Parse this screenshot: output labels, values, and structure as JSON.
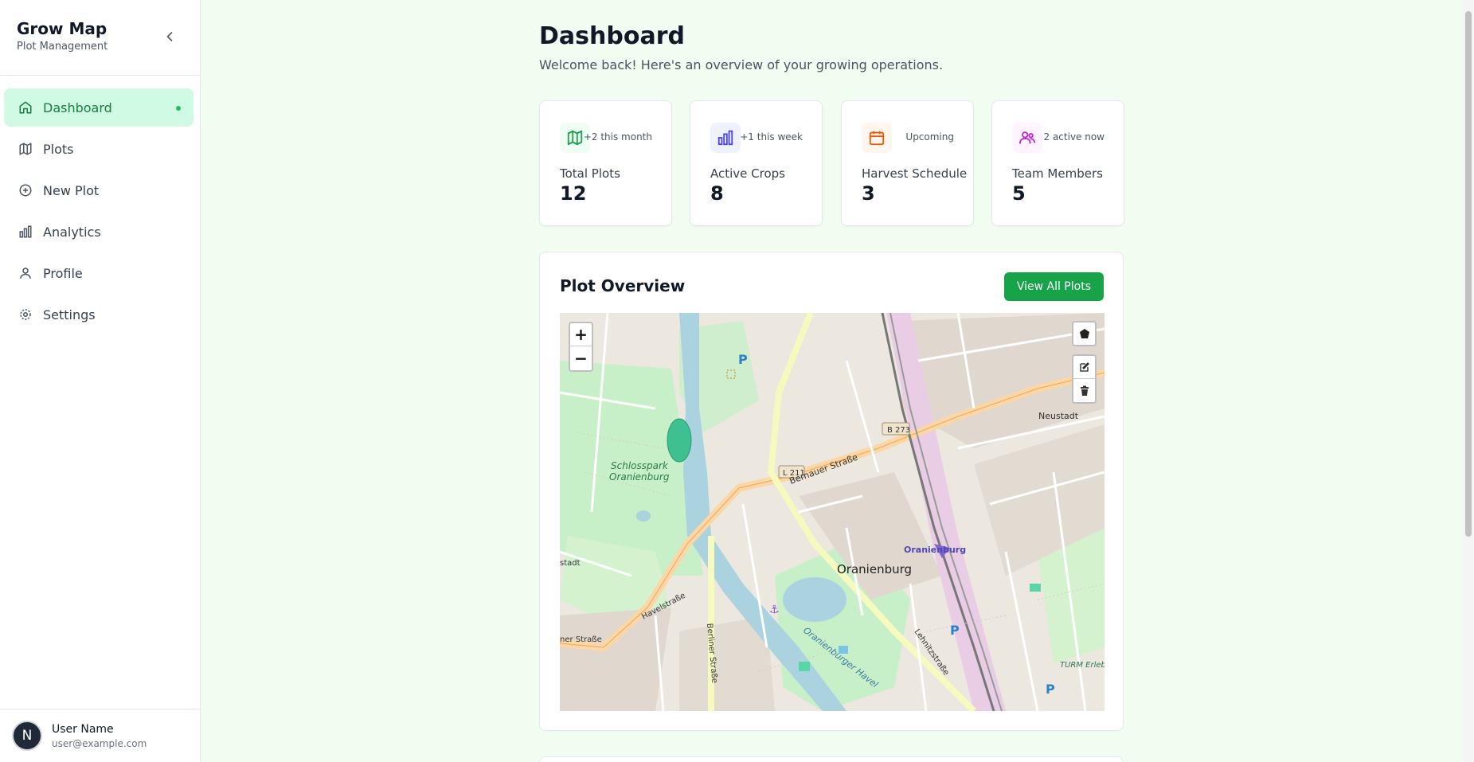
{
  "sidebar": {
    "brand_title": "Grow Map",
    "brand_subtitle": "Plot Management",
    "items": [
      {
        "label": "Dashboard",
        "icon": "home-icon",
        "active": true
      },
      {
        "label": "Plots",
        "icon": "map-icon"
      },
      {
        "label": "New Plot",
        "icon": "plus-circle-icon"
      },
      {
        "label": "Analytics",
        "icon": "bar-chart-icon"
      },
      {
        "label": "Profile",
        "icon": "user-icon"
      },
      {
        "label": "Settings",
        "icon": "gear-icon"
      }
    ],
    "user": {
      "initial": "N",
      "name": "User Name",
      "email": "user@example.com"
    }
  },
  "header": {
    "title": "Dashboard",
    "subtitle": "Welcome back! Here's an overview of your growing operations."
  },
  "stats": [
    {
      "label": "Total Plots",
      "value": "12",
      "badge": "+2 this month",
      "icon": "map-icon",
      "color": "#16a34a",
      "bg": "#f0fdf4"
    },
    {
      "label": "Active Crops",
      "value": "8",
      "badge": "+1 this week",
      "icon": "bar-chart-icon",
      "color": "#4f46e5",
      "bg": "#eef2ff"
    },
    {
      "label": "Harvest Schedule",
      "value": "3",
      "badge": "Upcoming",
      "icon": "calendar-icon",
      "color": "#ea580c",
      "bg": "#fff7ed"
    },
    {
      "label": "Team Members",
      "value": "5",
      "badge": "2 active now",
      "icon": "users-icon",
      "color": "#c026d3",
      "bg": "#fdf4ff"
    }
  ],
  "overview": {
    "title": "Plot Overview",
    "button": "View All Plots"
  },
  "map": {
    "zoom_in": "+",
    "zoom_out": "−",
    "labels": {
      "town": "Oranienburg",
      "park": "Schlosspark",
      "park2": "Oranienburg",
      "station": "Oranienburg",
      "neustadt": "Neustadt",
      "b273": "B 273",
      "l211": "L 211",
      "bernauer": "Bernauer Straße",
      "havelstr": "Havelstraße",
      "berliner": "Berliner Straße",
      "lehnitz": "Lehnitzstraße",
      "havel": "Oranienburger Havel",
      "turm": "TURM Erlebn",
      "strasse": "ner Straße",
      "stadt": "stadt",
      "parking": "P"
    }
  }
}
